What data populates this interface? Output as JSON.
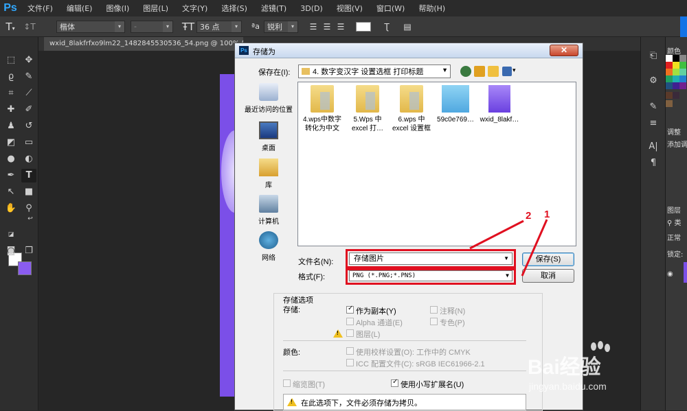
{
  "app": {
    "logo": "Ps"
  },
  "menu": [
    "文件(F)",
    "编辑(E)",
    "图像(I)",
    "图层(L)",
    "文字(Y)",
    "选择(S)",
    "滤镜(T)",
    "3D(D)",
    "视图(V)",
    "窗口(W)",
    "帮助(H)"
  ],
  "options": {
    "font_family": "楷体",
    "font_style": "-",
    "font_size": "36 点",
    "aa_label": "ªa",
    "aa_mode": "锐利"
  },
  "document_tab": "wxid_8lakfrfxo9lm22_1482845530536_54.png @ 100% (图层 0, RGB/8)",
  "right_panel": {
    "color_tab": "颜色",
    "adjust_tab": "调整",
    "adjust_add": "添加调",
    "layers_tab": "图层",
    "filter_kind": "类",
    "blend_mode": "正常",
    "lock_label": "锁定:"
  },
  "dialog": {
    "title": "存储为",
    "save_in_label": "保存在(I):",
    "save_in_value": "4. 数字变汉字 设置选框  打印标题",
    "places": [
      "最近访问的位置",
      "桌面",
      "库",
      "计算机",
      "网络"
    ],
    "files": [
      {
        "line1": "4.wps中数字",
        "line2": "转化为中文",
        "type": "folder"
      },
      {
        "line1": "5.Wps 中",
        "line2": "excel 打…",
        "type": "folder"
      },
      {
        "line1": "6.wps 中",
        "line2": "excel 设置框",
        "type": "folder"
      },
      {
        "line1": "59c0e769…",
        "line2": "",
        "type": "image-blue"
      },
      {
        "line1": "wxid_8lakf…",
        "line2": "",
        "type": "image-purple"
      }
    ],
    "filename_label": "文件名(N):",
    "filename_value": "存储图片",
    "format_label": "格式(F):",
    "format_value": "PNG (*.PNG;*.PNS)",
    "save_button": "保存(S)",
    "cancel_button": "取消",
    "annotation_1": "1",
    "annotation_2": "2",
    "save_options_title": "存储选项",
    "store_label": "存储:",
    "as_copy": "作为副本(Y)",
    "alpha": "Alpha 通道(E)",
    "layers": "图层(L)",
    "notes": "注释(N)",
    "spot": "专色(P)",
    "color_label": "颜色:",
    "use_proof": "使用校样设置(O): 工作中的 CMYK",
    "icc_profile": "ICC 配置文件(C): sRGB IEC61966-2.1",
    "thumbnail": "缩览图(T)",
    "lowercase_ext": "使用小写扩展名(U)",
    "message": "在此选项下，文件必须存储为拷贝。"
  },
  "watermark": {
    "brand": "Bai经验",
    "url": "jingyan.baidu.com"
  },
  "colors": {
    "accent_red": "#e01020",
    "ps_blue": "#31a8ff",
    "fg_color": "#ffffff",
    "bg_color": "#8a5cf0"
  }
}
